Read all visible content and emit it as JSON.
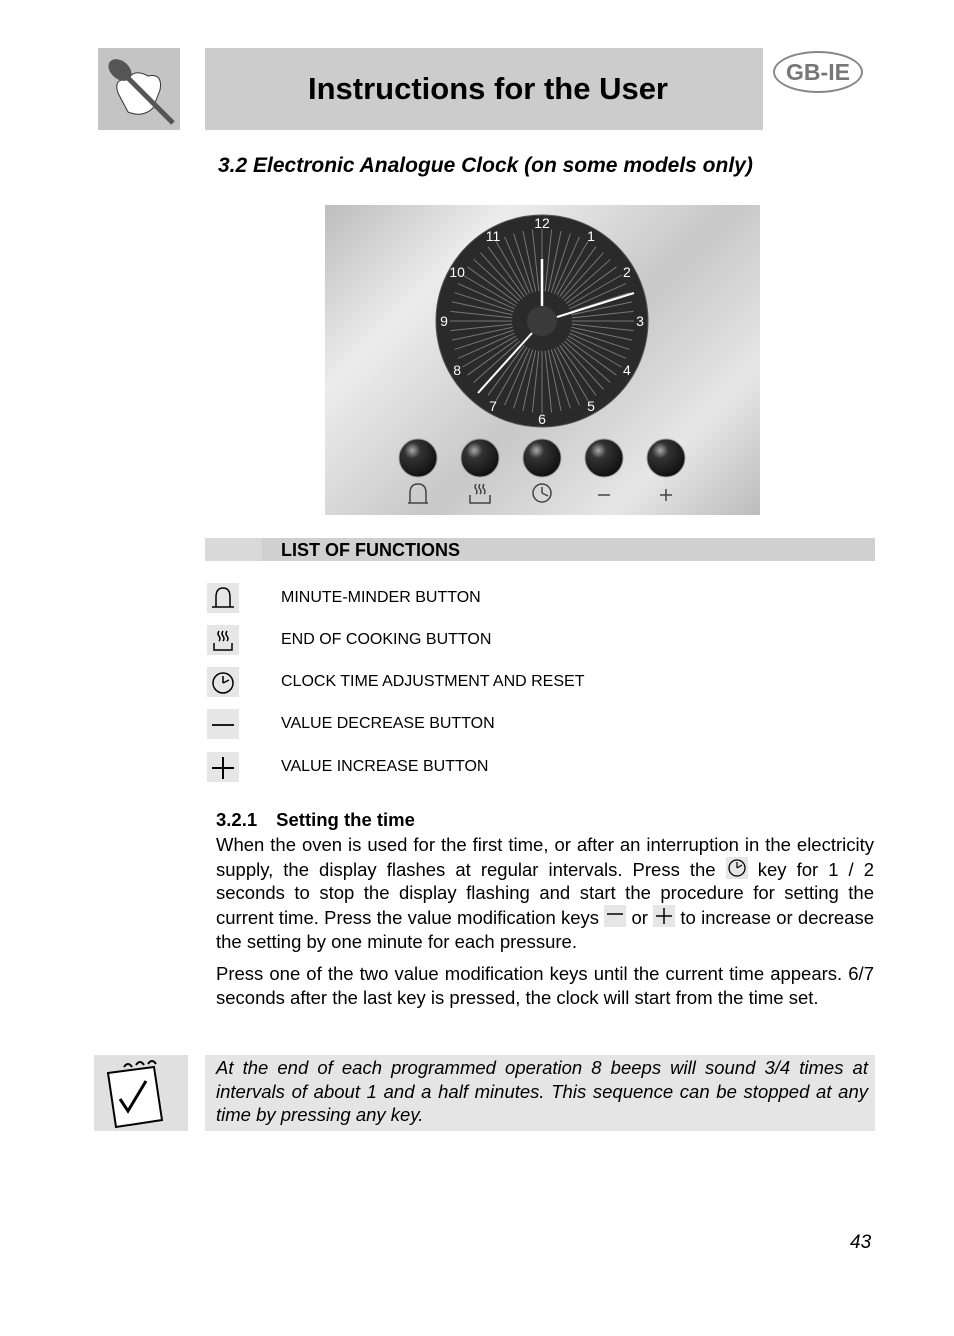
{
  "header": {
    "title": "Instructions for the User",
    "badge": "GB-IE",
    "logo": "chef-hat-spoon-logo"
  },
  "section": {
    "title": "3.2 Electronic Analogue Clock (on some models only)"
  },
  "clock": {
    "numbers": [
      "12",
      "1",
      "2",
      "3",
      "4",
      "5",
      "6",
      "7",
      "8",
      "9",
      "10",
      "11"
    ],
    "buttons": [
      "minute-minder",
      "end-of-cooking",
      "clock",
      "minus",
      "plus"
    ]
  },
  "functions": {
    "heading": "LIST OF FUNCTIONS",
    "items": [
      {
        "icon": "bell-icon",
        "label": "MINUTE-MINDER BUTTON"
      },
      {
        "icon": "end-cooking-icon",
        "label": "END OF COOKING BUTTON"
      },
      {
        "icon": "clock-icon",
        "label": "CLOCK TIME ADJUSTMENT AND RESET"
      },
      {
        "icon": "minus-icon",
        "label": "VALUE DECREASE BUTTON"
      },
      {
        "icon": "plus-icon",
        "label": "VALUE INCREASE BUTTON"
      }
    ]
  },
  "setting": {
    "heading_num": "3.2.1",
    "heading": "Setting the time",
    "p1a": "When the oven is used for the first time, or after an interruption in the electricity supply, the display flashes at regular intervals. Press the",
    "p1b": "key for 1 / 2 seconds to stop the display flashing and start the procedure for setting the current time. Press the value modification keys",
    "p1or": "or",
    "p1c": "to increase or decrease the setting by one minute for each pressure.",
    "p2": "Press one of the two value modification keys until the current time appears. 6/7 seconds after the last key is pressed, the clock will start from the time set."
  },
  "note": {
    "text": "At the end of each programmed operation 8 beeps will sound 3/4 times at intervals of about 1 and a half minutes. This sequence can be stopped at any time by pressing any key."
  },
  "page_number": "43"
}
